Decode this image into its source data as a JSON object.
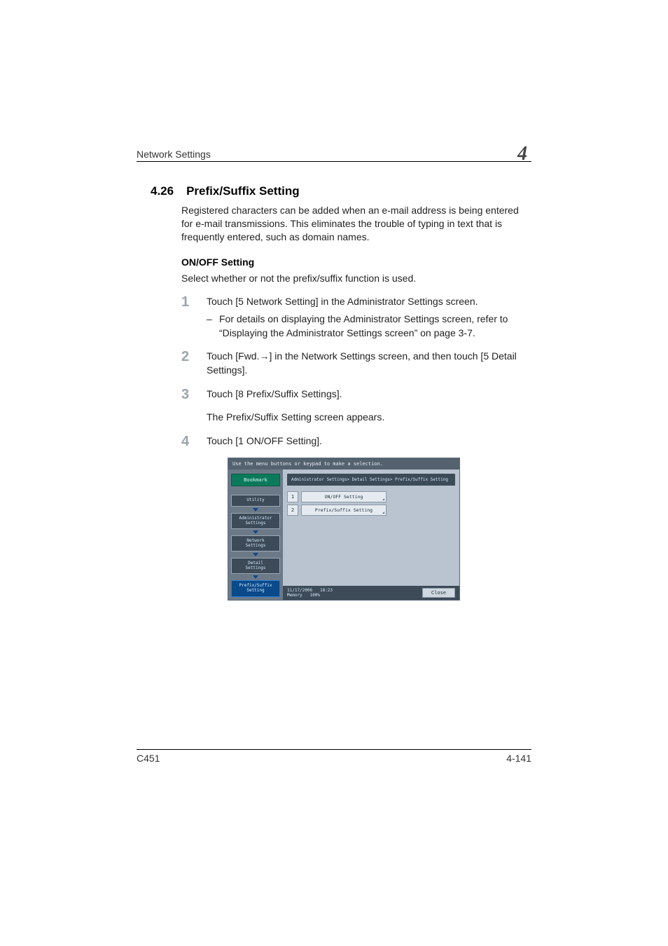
{
  "header": {
    "section_name": "Network Settings",
    "chapter_number": "4"
  },
  "section": {
    "number": "4.26",
    "title": "Prefix/Suffix Setting",
    "intro": "Registered characters can be added when an e-mail address is being entered for e-mail transmissions. This eliminates the trouble of typing in text that is frequently entered, such as domain names."
  },
  "subsection": {
    "title": "ON/OFF Setting",
    "desc": "Select whether or not the prefix/suffix function is used."
  },
  "steps": {
    "s1": {
      "num": "1",
      "text": "Touch [5 Network Setting] in the Administrator Settings screen.",
      "sub": "For details on displaying the Administrator Settings screen, refer to “Displaying the Administrator Settings screen” on page 3-7."
    },
    "s2": {
      "num": "2",
      "text_a": "Touch [Fwd.",
      "arrow": "→",
      "text_b": "] in the Network Settings screen, and then touch [5 Detail Settings]."
    },
    "s3": {
      "num": "3",
      "text": "Touch [8 Prefix/Suffix Settings].",
      "after": "The Prefix/Suffix Setting screen appears."
    },
    "s4": {
      "num": "4",
      "text": "Touch [1 ON/OFF Setting]."
    }
  },
  "panel": {
    "top_hint": "Use the menu buttons or keypad to make a selection.",
    "bookmark": "Bookmark",
    "crumbs": {
      "utility": "Utility",
      "admin": "Administrator\nSettings",
      "network": "Network\nSettings",
      "detail": "Detail\nSettings",
      "prefix": "Prefix/Suffix\nSetting"
    },
    "breadcrumb_bar": "Administrator Settings> Detail Settings> Prefix/Suffix Setting",
    "menu": {
      "i1": "1",
      "l1": "ON/OFF Setting",
      "i2": "2",
      "l2": "Prefix/Suffix Setting"
    },
    "footer": {
      "date": "11/17/2006",
      "time": "18:23",
      "mem_label": "Memory",
      "mem_val": "100%",
      "close": "Close"
    }
  },
  "footer": {
    "model": "C451",
    "page": "4-141"
  }
}
